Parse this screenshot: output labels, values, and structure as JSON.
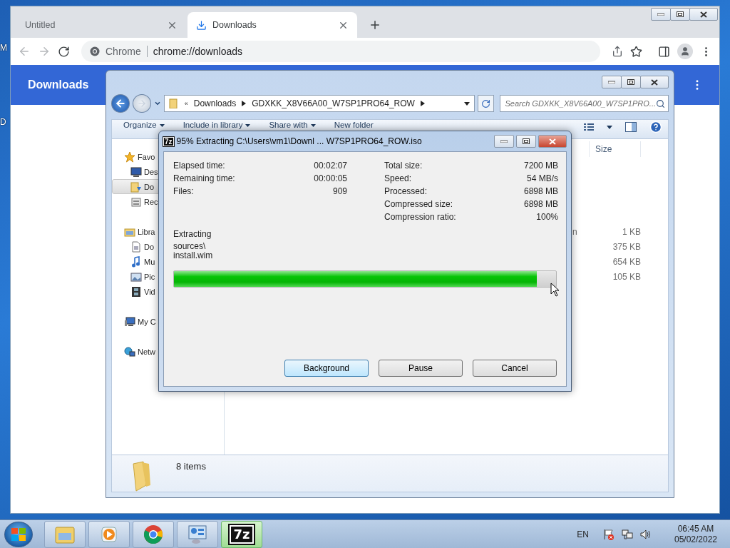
{
  "desktop": {
    "icon_labels": [
      "M",
      "D"
    ]
  },
  "browser": {
    "tabs": [
      {
        "label": "Untitled",
        "selected": false
      },
      {
        "label": "Downloads",
        "selected": true
      }
    ],
    "address": {
      "scheme_label": "Chrome",
      "url": "chrome://downloads"
    },
    "page_title": "Downloads"
  },
  "explorer": {
    "breadcrumb_prefix": "«",
    "breadcrumb": [
      "Downloads",
      "GDXKK_X8V66A00_W7SP1PRO64_ROW"
    ],
    "search_placeholder": "Search GDXKK_X8V66A00_W7SP1PRO...",
    "toolbar": [
      {
        "label": "Organize",
        "dropdown": true
      },
      {
        "label": "Include in library",
        "dropdown": true
      },
      {
        "label": "Share with",
        "dropdown": true
      },
      {
        "label": "New folder",
        "dropdown": false
      }
    ],
    "nav": [
      {
        "label": "Favo",
        "kind": "star",
        "selected": false,
        "children": [
          {
            "label": "Des",
            "kind": "desktop",
            "selected": false
          },
          {
            "label": "Do",
            "kind": "downloads",
            "selected": true
          },
          {
            "label": "Rec",
            "kind": "recent",
            "selected": false
          }
        ]
      },
      {
        "label": "Libra",
        "kind": "library",
        "selected": false,
        "children": [
          {
            "label": "Do",
            "kind": "document",
            "selected": false
          },
          {
            "label": "Mu",
            "kind": "music",
            "selected": false
          },
          {
            "label": "Pic",
            "kind": "picture",
            "selected": false
          },
          {
            "label": "Vid",
            "kind": "video",
            "selected": false
          }
        ]
      },
      {
        "label": "My C",
        "kind": "computer",
        "selected": false
      },
      {
        "label": "Netw",
        "kind": "network",
        "selected": false
      }
    ],
    "column_header": "Size",
    "rows": [
      {
        "name": "n",
        "size": "1 KB"
      },
      {
        "name": null,
        "size": "375 KB"
      },
      {
        "name": null,
        "size": "654 KB"
      },
      {
        "name": null,
        "size": "105 KB"
      }
    ],
    "status": "8 items"
  },
  "dialog": {
    "icon_text": "7z",
    "title": "95% Extracting C:\\Users\\vm1\\Downl ... W7SP1PRO64_ROW.iso",
    "left_stats": [
      {
        "label": "Elapsed time:",
        "value": "00:02:07"
      },
      {
        "label": "Remaining time:",
        "value": "00:00:05"
      },
      {
        "label": "Files:",
        "value": "909"
      }
    ],
    "right_stats": [
      {
        "label": "Total size:",
        "value": "7200 MB"
      },
      {
        "label": "Speed:",
        "value": "54 MB/s"
      },
      {
        "label": "Processed:",
        "value": "6898 MB"
      },
      {
        "label": "Compressed size:",
        "value": "6898 MB"
      },
      {
        "label": "Compression ratio:",
        "value": "100%"
      }
    ],
    "status_label": "Extracting",
    "current_file": [
      "sources\\",
      "install.wim"
    ],
    "progress": {
      "level": 0.95
    },
    "buttons": [
      {
        "label": "Background",
        "default": true
      },
      {
        "label": "Pause",
        "default": false
      },
      {
        "label": "Cancel",
        "default": false
      }
    ]
  },
  "taskbar": {
    "apps": [
      {
        "kind": "explorer",
        "active": false
      },
      {
        "kind": "media",
        "active": false
      },
      {
        "kind": "chrome",
        "active": false
      },
      {
        "kind": "control",
        "active": false
      },
      {
        "kind": "sevenzip",
        "label": "7z",
        "active": true
      }
    ],
    "language": "EN",
    "time": "06:45 AM",
    "date": "05/02/2022"
  }
}
